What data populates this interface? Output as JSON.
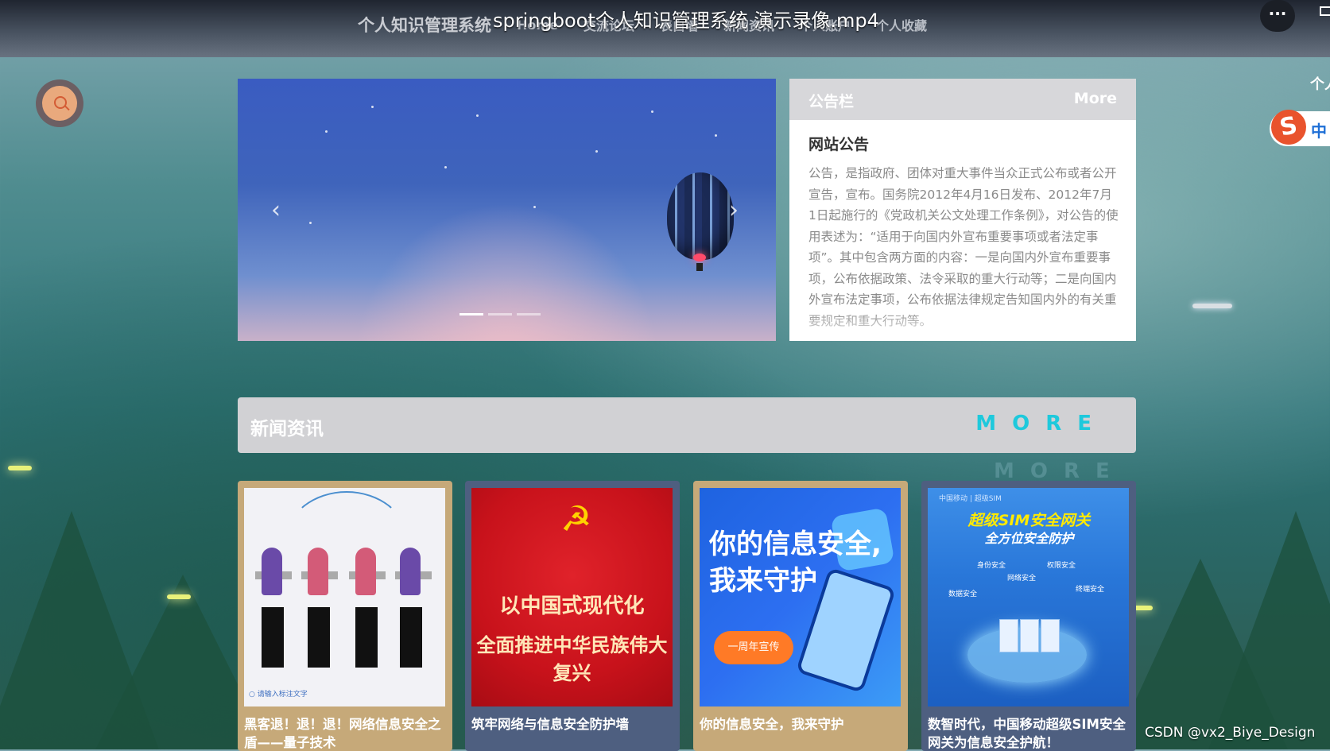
{
  "top_nav": {
    "brand": "个人知识管理系统",
    "items": [
      "Home",
      "交流论坛",
      "表白墙",
      "新闻资讯",
      "个人账户",
      "个人收藏"
    ]
  },
  "video_player": {
    "title": "springboot个人知识管理系统 演示录像.mp4",
    "more_icon": "more-dots-icon",
    "more_label": "···"
  },
  "right_edge": {
    "personal_center_label": "个人",
    "ime_label": "中",
    "ime_logo": "S"
  },
  "search_icon": "search-icon",
  "carousel": {
    "prev_icon": "chevron-left-icon",
    "prev_glyph": "‹",
    "next_icon": "chevron-right-icon",
    "next_glyph": "›",
    "slide_count": 3,
    "active_index": 0
  },
  "notice": {
    "header": "公告栏",
    "more": "More",
    "title": "网站公告",
    "body": "公告，是指政府、团体对重大事件当众正式公布或者公开宣告，宣布。国务院2012年4月16日发布、2012年7月1日起施行的《党政机关公文处理工作条例》，对公告的使用表述为：“适用于向国内外宣布重要事项或者法定事项”。其中包含两方面的内容：一是向国内外宣布重要事项，公布依据政策、法令采取的重大行动等；二是向国内外宣布法定事项，公布依据法律规定告知国内外的有关重要规定和重大行动等。"
  },
  "news": {
    "title": "新闻资讯",
    "more": "MORE",
    "ghost_more": "MORE",
    "cards": [
      {
        "caption": "黑客退！退！退！网络信息安全之盾——量子技术",
        "image_footer": "○ 请输入标注文字"
      },
      {
        "caption": "筑牢网络与信息安全防护墙",
        "image_line1": "以中国式现代化",
        "image_line2": "全面推进中华民族伟大复兴",
        "emblem": "☭"
      },
      {
        "caption": "你的信息安全，我来守护",
        "image_headline_1": "你的信息安全,",
        "image_headline_2": "我来守护",
        "image_pill": "一周年宣传"
      },
      {
        "caption": "数智时代，中国移动超级SIM安全网关为信息安全护航！",
        "image_top": "中国移动 | 超级SIM",
        "image_title_1": "超级SIM安全网关",
        "image_title_2": "全方位安全防护",
        "labels": [
          "身份安全",
          "权限安全",
          "网络安全",
          "数据安全",
          "终端安全"
        ]
      }
    ]
  },
  "watermark": "CSDN @vx2_Biye_Design",
  "colors": {
    "accent_more": "#1ec9dc",
    "header_gray": "#d1d1d4",
    "card_beige": "#c6a979",
    "card_blue": "#4e5f80"
  }
}
